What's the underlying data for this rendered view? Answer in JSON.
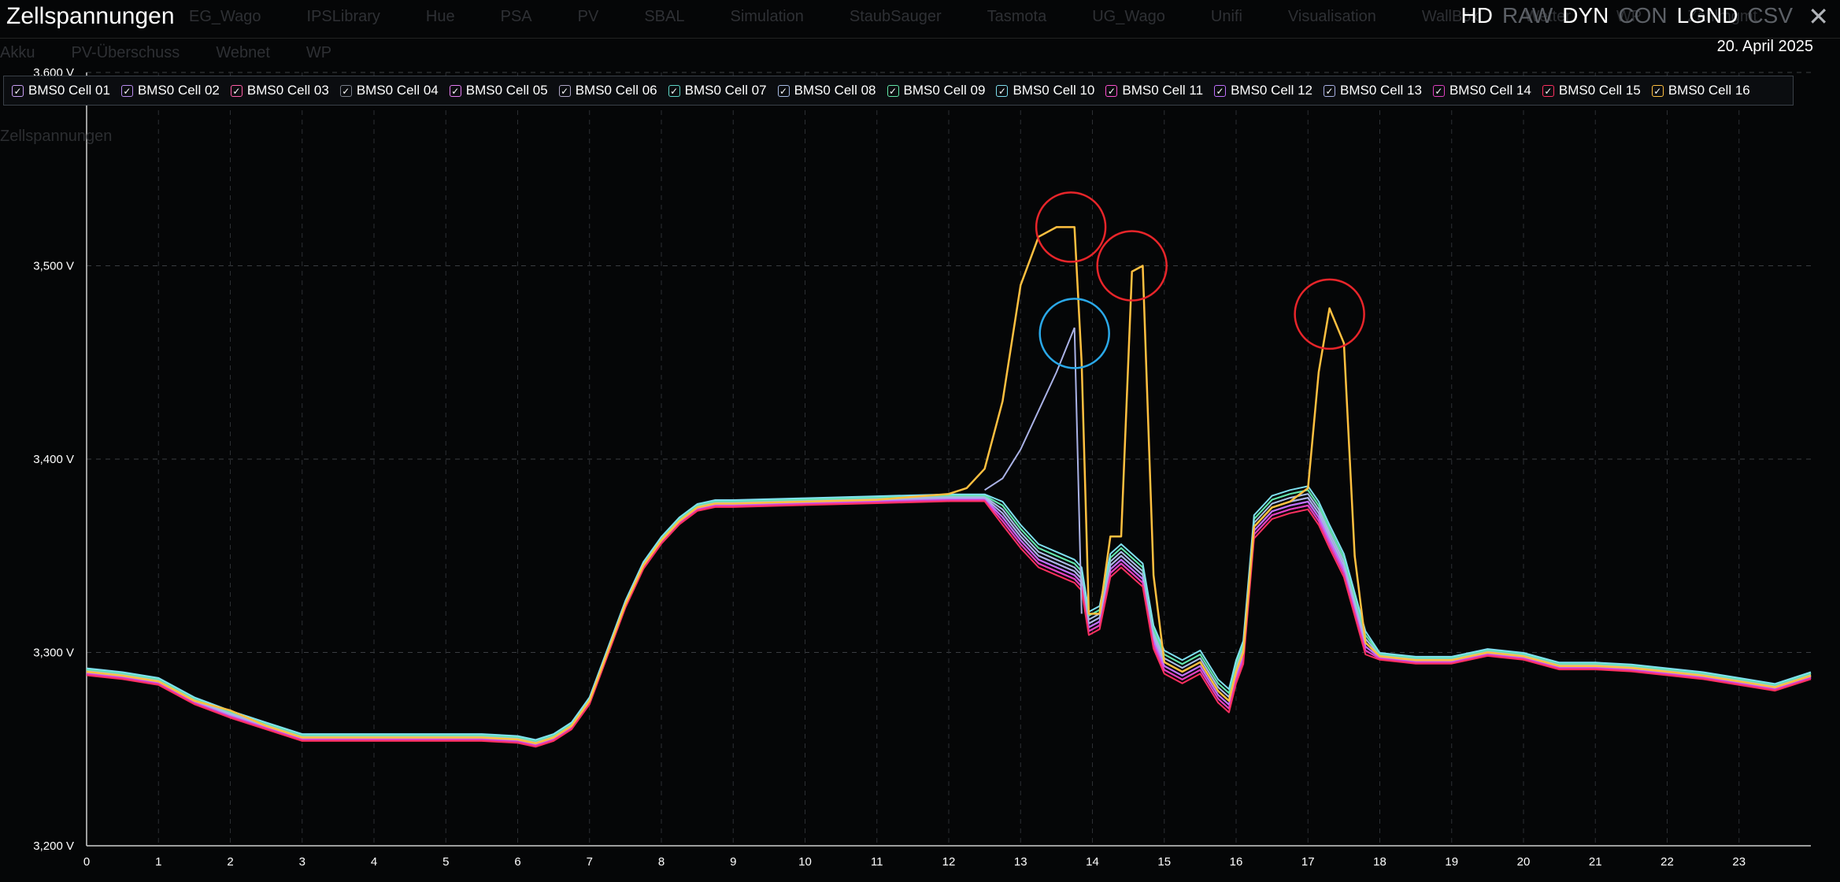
{
  "header": {
    "title": "Zellspannungen",
    "date": "20. April 2025",
    "tabs": [
      "EG_Wago",
      "IPSLibrary",
      "Hue",
      "PSA",
      "PV",
      "SBAL",
      "Simulation",
      "StaubSauger",
      "Tasmota",
      "UG_Wago",
      "Unifi",
      "Visualisation",
      "WallBox",
      "Wetter",
      "WP",
      "Zählmgmt"
    ],
    "tabs2": [
      "Akku",
      "PV-Überschuss",
      "Webnet",
      "WP"
    ],
    "modes": [
      {
        "label": "HD",
        "active": true
      },
      {
        "label": "RAW",
        "active": false
      },
      {
        "label": "DYN",
        "active": true
      },
      {
        "label": "CON",
        "active": false
      },
      {
        "label": "LGND",
        "active": true
      },
      {
        "label": "CSV",
        "active": false
      }
    ],
    "close_icon": "close-icon"
  },
  "subtitle": "Zellspannungen",
  "chart_data": {
    "type": "line",
    "xlim": [
      0,
      24
    ],
    "ylim": [
      3200,
      3600
    ],
    "x_ticks": [
      "0",
      "1",
      "2",
      "3",
      "4",
      "5",
      "6",
      "7",
      "8",
      "9",
      "10",
      "11",
      "12",
      "13",
      "14",
      "15",
      "16",
      "17",
      "18",
      "19",
      "20",
      "21",
      "22",
      "23"
    ],
    "y_ticks": [
      "3,200 V",
      "3,300 V",
      "3,400 V",
      "3,500 V",
      "3,600 V"
    ],
    "grid": true,
    "legend_position": "top",
    "x": [
      0,
      0.5,
      1,
      1.5,
      2,
      2.5,
      3,
      3.5,
      4,
      4.5,
      5,
      5.5,
      6,
      6.25,
      6.5,
      6.75,
      7,
      7.25,
      7.5,
      7.75,
      8,
      8.25,
      8.5,
      8.75,
      9,
      10,
      11,
      12,
      12.25,
      12.5,
      12.75,
      13,
      13.25,
      13.5,
      13.75,
      13.85,
      13.95,
      14.1,
      14.25,
      14.4,
      14.55,
      14.7,
      14.85,
      15,
      15.25,
      15.5,
      15.75,
      15.9,
      16,
      16.1,
      16.25,
      16.5,
      16.75,
      17,
      17.15,
      17.3,
      17.5,
      17.65,
      17.8,
      18,
      18.5,
      19,
      19.5,
      20,
      20.5,
      21,
      21.5,
      22,
      22.5,
      23,
      23.5,
      24
    ],
    "base": [
      3290,
      3288,
      3285,
      3275,
      3268,
      3262,
      3256,
      3256,
      3256,
      3256,
      3256,
      3256,
      3255,
      3253,
      3256,
      3262,
      3275,
      3300,
      3325,
      3345,
      3358,
      3368,
      3375,
      3377,
      3377,
      3378,
      3379,
      3380,
      3380,
      3380,
      3372,
      3360,
      3350,
      3346,
      3342,
      3338,
      3315,
      3318,
      3345,
      3350,
      3345,
      3340,
      3308,
      3295,
      3290,
      3295,
      3280,
      3275,
      3290,
      3300,
      3365,
      3375,
      3378,
      3380,
      3372,
      3360,
      3345,
      3325,
      3305,
      3298,
      3296,
      3296,
      3300,
      3298,
      3293,
      3293,
      3292,
      3290,
      3288,
      3285,
      3282,
      3288
    ],
    "series": [
      {
        "name": "BMS0 Cell 01",
        "color": "#c9a0f5",
        "offset": 0
      },
      {
        "name": "BMS0 Cell 02",
        "color": "#b98df0",
        "offset": -1
      },
      {
        "name": "BMS0 Cell 03",
        "color": "#ff5fa8",
        "offset": -2
      },
      {
        "name": "BMS0 Cell 04",
        "color": "#7a7f8a",
        "offset": 1
      },
      {
        "name": "BMS0 Cell 05",
        "color": "#e57cf2",
        "offset": -1
      },
      {
        "name": "BMS0 Cell 06",
        "color": "#b0a8c8",
        "offset": 0
      },
      {
        "name": "BMS0 Cell 07",
        "color": "#5ed6c8",
        "offset": 2
      },
      {
        "name": "BMS0 Cell 08",
        "color": "#a9bde6",
        "offset": 1
      },
      {
        "name": "BMS0 Cell 09",
        "color": "#62e6a8",
        "offset": 2
      },
      {
        "name": "BMS0 Cell 10",
        "color": "#7fe0f0",
        "offset": 3
      },
      {
        "name": "BMS0 Cell 11",
        "color": "#ff4fd0",
        "offset": -2
      },
      {
        "name": "BMS0 Cell 12",
        "color": "#c070ff",
        "offset": -1
      },
      {
        "name": "BMS0 Cell 13",
        "color": "#aab2e6",
        "offset": 0
      },
      {
        "name": "BMS0 Cell 14",
        "color": "#e040c0",
        "offset": -2
      },
      {
        "name": "BMS0 Cell 15",
        "color": "#ff3060",
        "offset": -3
      },
      {
        "name": "BMS0 Cell 16",
        "color": "#ffc040",
        "offset": 0
      }
    ],
    "cell16": [
      3290,
      3288,
      3285,
      3275,
      3270,
      3262,
      3256,
      3256,
      3256,
      3256,
      3256,
      3256,
      3255,
      3253,
      3256,
      3262,
      3275,
      3300,
      3325,
      3345,
      3358,
      3368,
      3375,
      3377,
      3377,
      3378,
      3379,
      3382,
      3385,
      3395,
      3430,
      3490,
      3515,
      3520,
      3520,
      3450,
      3320,
      3320,
      3360,
      3360,
      3497,
      3500,
      3340,
      3295,
      3290,
      3295,
      3280,
      3275,
      3290,
      3300,
      3365,
      3375,
      3378,
      3385,
      3445,
      3478,
      3460,
      3350,
      3305,
      3298,
      3296,
      3296,
      3300,
      3298,
      3293,
      3293,
      3292,
      3290,
      3288,
      3285,
      3282,
      3288
    ],
    "cell13_x": [
      12.5,
      12.75,
      13,
      13.25,
      13.5,
      13.75,
      13.85
    ],
    "cell13_y": [
      3384,
      3390,
      3405,
      3425,
      3445,
      3468,
      3320
    ],
    "annotations": [
      {
        "x": 13.7,
        "y": 3520,
        "color": "#e8252a"
      },
      {
        "x": 14.55,
        "y": 3500,
        "color": "#e8252a"
      },
      {
        "x": 17.3,
        "y": 3475,
        "color": "#e8252a"
      },
      {
        "x": 13.75,
        "y": 3465,
        "color": "#2aa8e8"
      }
    ]
  }
}
